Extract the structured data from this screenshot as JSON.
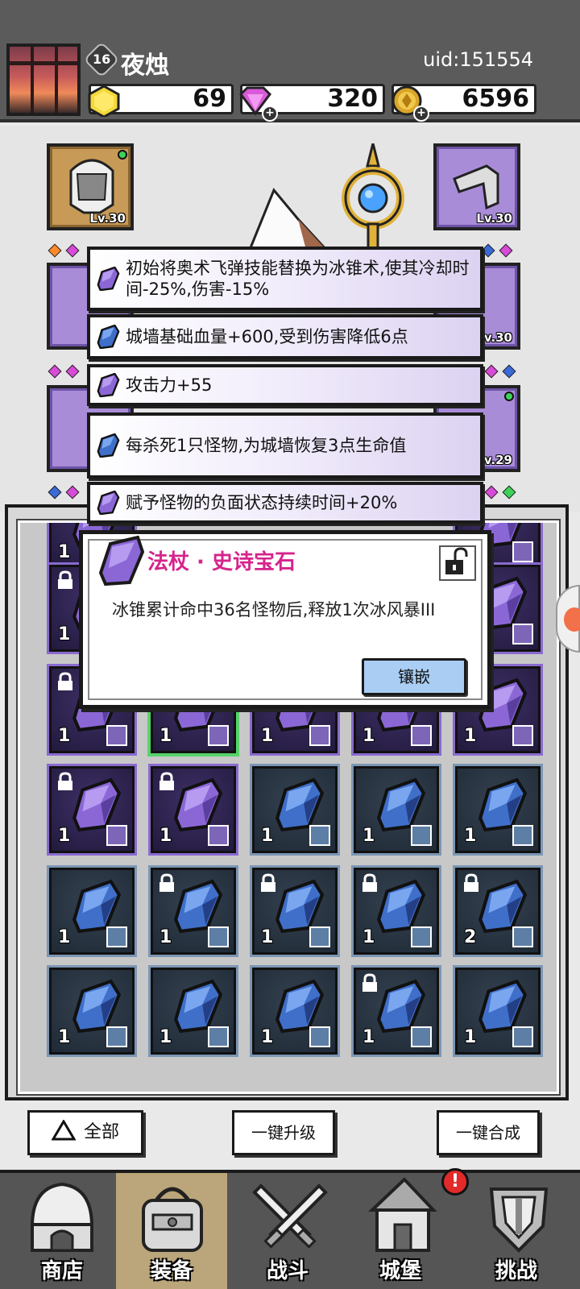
{
  "header": {
    "player_level": "16",
    "player_name": "夜烛",
    "uid": "uid:151554",
    "gold": "69",
    "gems": "320",
    "coins": "6596"
  },
  "equipment": {
    "slots": [
      {
        "name": "helmet",
        "level": "Lv.30"
      },
      {
        "name": "gloves",
        "level": "Lv.30"
      },
      {
        "name": "left-mid",
        "level": ""
      },
      {
        "name": "right-mid",
        "level": "Lv.30"
      },
      {
        "name": "boots",
        "level": ""
      },
      {
        "name": "ring",
        "level": "Lv.29"
      }
    ]
  },
  "stat_list": [
    {
      "text": "初始将奥术飞弹技能替换为冰锥术,使其冷却时间-25%,伤害-15%",
      "gem": "epic"
    },
    {
      "text": "城墙基础血量+600,受到伤害降低6点",
      "gem": "rare"
    },
    {
      "text": "攻击力+55",
      "gem": "epic"
    },
    {
      "text": "每杀死1只怪物,为城墙恢复3点生命值",
      "gem": "rare"
    },
    {
      "text": "赋予怪物的负面状态持续时间+20%",
      "gem": "epic"
    }
  ],
  "popup": {
    "title": "法杖 · 史诗宝石",
    "description": "冰锥累计命中36名怪物后,释放1次冰风暴III",
    "inlay_label": "镶嵌",
    "lock_icon": "unlock-icon"
  },
  "inventory": {
    "rows": [
      [
        {
          "type": "epic",
          "count": "1",
          "lock": false
        },
        {
          "type": "hidden"
        },
        {
          "type": "hidden"
        },
        {
          "type": "hidden"
        },
        {
          "type": "epic",
          "count": "",
          "lock": false
        }
      ],
      [
        {
          "type": "epic",
          "count": "1",
          "lock": true
        },
        {
          "type": "hidden"
        },
        {
          "type": "hidden"
        },
        {
          "type": "hidden"
        },
        {
          "type": "epic",
          "count": "",
          "lock": false
        }
      ],
      [
        {
          "type": "epic",
          "count": "1",
          "lock": true
        },
        {
          "type": "epic",
          "count": "1",
          "lock": false,
          "selected": true
        },
        {
          "type": "epic",
          "count": "1",
          "lock": false
        },
        {
          "type": "epic",
          "count": "1",
          "lock": false
        },
        {
          "type": "epic",
          "count": "1",
          "lock": true
        }
      ],
      [
        {
          "type": "epic",
          "count": "1",
          "lock": true
        },
        {
          "type": "epic",
          "count": "1",
          "lock": true
        },
        {
          "type": "rare",
          "count": "1",
          "lock": false
        },
        {
          "type": "rare",
          "count": "1",
          "lock": false
        },
        {
          "type": "rare",
          "count": "1",
          "lock": false
        }
      ],
      [
        {
          "type": "rare",
          "count": "1",
          "lock": false
        },
        {
          "type": "rare",
          "count": "1",
          "lock": true
        },
        {
          "type": "rare",
          "count": "1",
          "lock": true
        },
        {
          "type": "rare",
          "count": "1",
          "lock": true
        },
        {
          "type": "rare",
          "count": "2",
          "lock": true
        }
      ],
      [
        {
          "type": "rare",
          "count": "1",
          "lock": false
        },
        {
          "type": "rare",
          "count": "1",
          "lock": false
        },
        {
          "type": "rare",
          "count": "1",
          "lock": false
        },
        {
          "type": "rare",
          "count": "1",
          "lock": true
        },
        {
          "type": "rare",
          "count": "1",
          "lock": false
        }
      ]
    ]
  },
  "actions": {
    "filter_label": "全部",
    "upgrade_all_label": "一键升级",
    "merge_all_label": "一键合成"
  },
  "nav": {
    "items": [
      "商店",
      "装备",
      "战斗",
      "城堡",
      "挑战"
    ],
    "active_index": 1,
    "alert": "!"
  },
  "colors": {
    "epic": "#8a6ad0",
    "rare": "#4f74b8",
    "accent_pink": "#d6248c",
    "selected_green": "#56d26a"
  }
}
